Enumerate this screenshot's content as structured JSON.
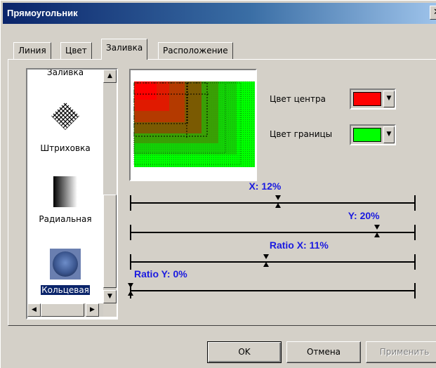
{
  "window": {
    "title": "Прямоугольник",
    "close_glyph": "✕"
  },
  "tabs": [
    {
      "label": "Линия",
      "active": false
    },
    {
      "label": "Цвет",
      "active": false
    },
    {
      "label": "Заливка",
      "active": true
    },
    {
      "label": "Расположение",
      "active": false
    }
  ],
  "fill_types": {
    "items": [
      {
        "label": "Заливка",
        "icon": "solid-fill-icon"
      },
      {
        "label": "Штриховка",
        "icon": "crosshatch-icon"
      },
      {
        "label": "Радиальная",
        "icon": "gradient-icon"
      },
      {
        "label": "Кольцевая",
        "icon": "sphere-icon",
        "selected": true
      }
    ],
    "scroll_up_glyph": "▲",
    "scroll_down_glyph": "▼",
    "scroll_left_glyph": "◀",
    "scroll_right_glyph": "▶"
  },
  "colors": {
    "center_label": "Цвет центра",
    "center_color": "#ff0000",
    "border_label": "Цвет границы",
    "border_color": "#00ff00",
    "dropdown_glyph": "▼"
  },
  "sliders": [
    {
      "label": "X: 12%",
      "value_percent": 12
    },
    {
      "label": "Y: 20%",
      "value_percent": 20
    },
    {
      "label": "Ratio X: 11%",
      "value_percent": 11
    },
    {
      "label": "Ratio Y: 0%",
      "value_percent": 0
    }
  ],
  "buttons": {
    "ok": "OK",
    "cancel": "Отмена",
    "apply": "Применить"
  }
}
